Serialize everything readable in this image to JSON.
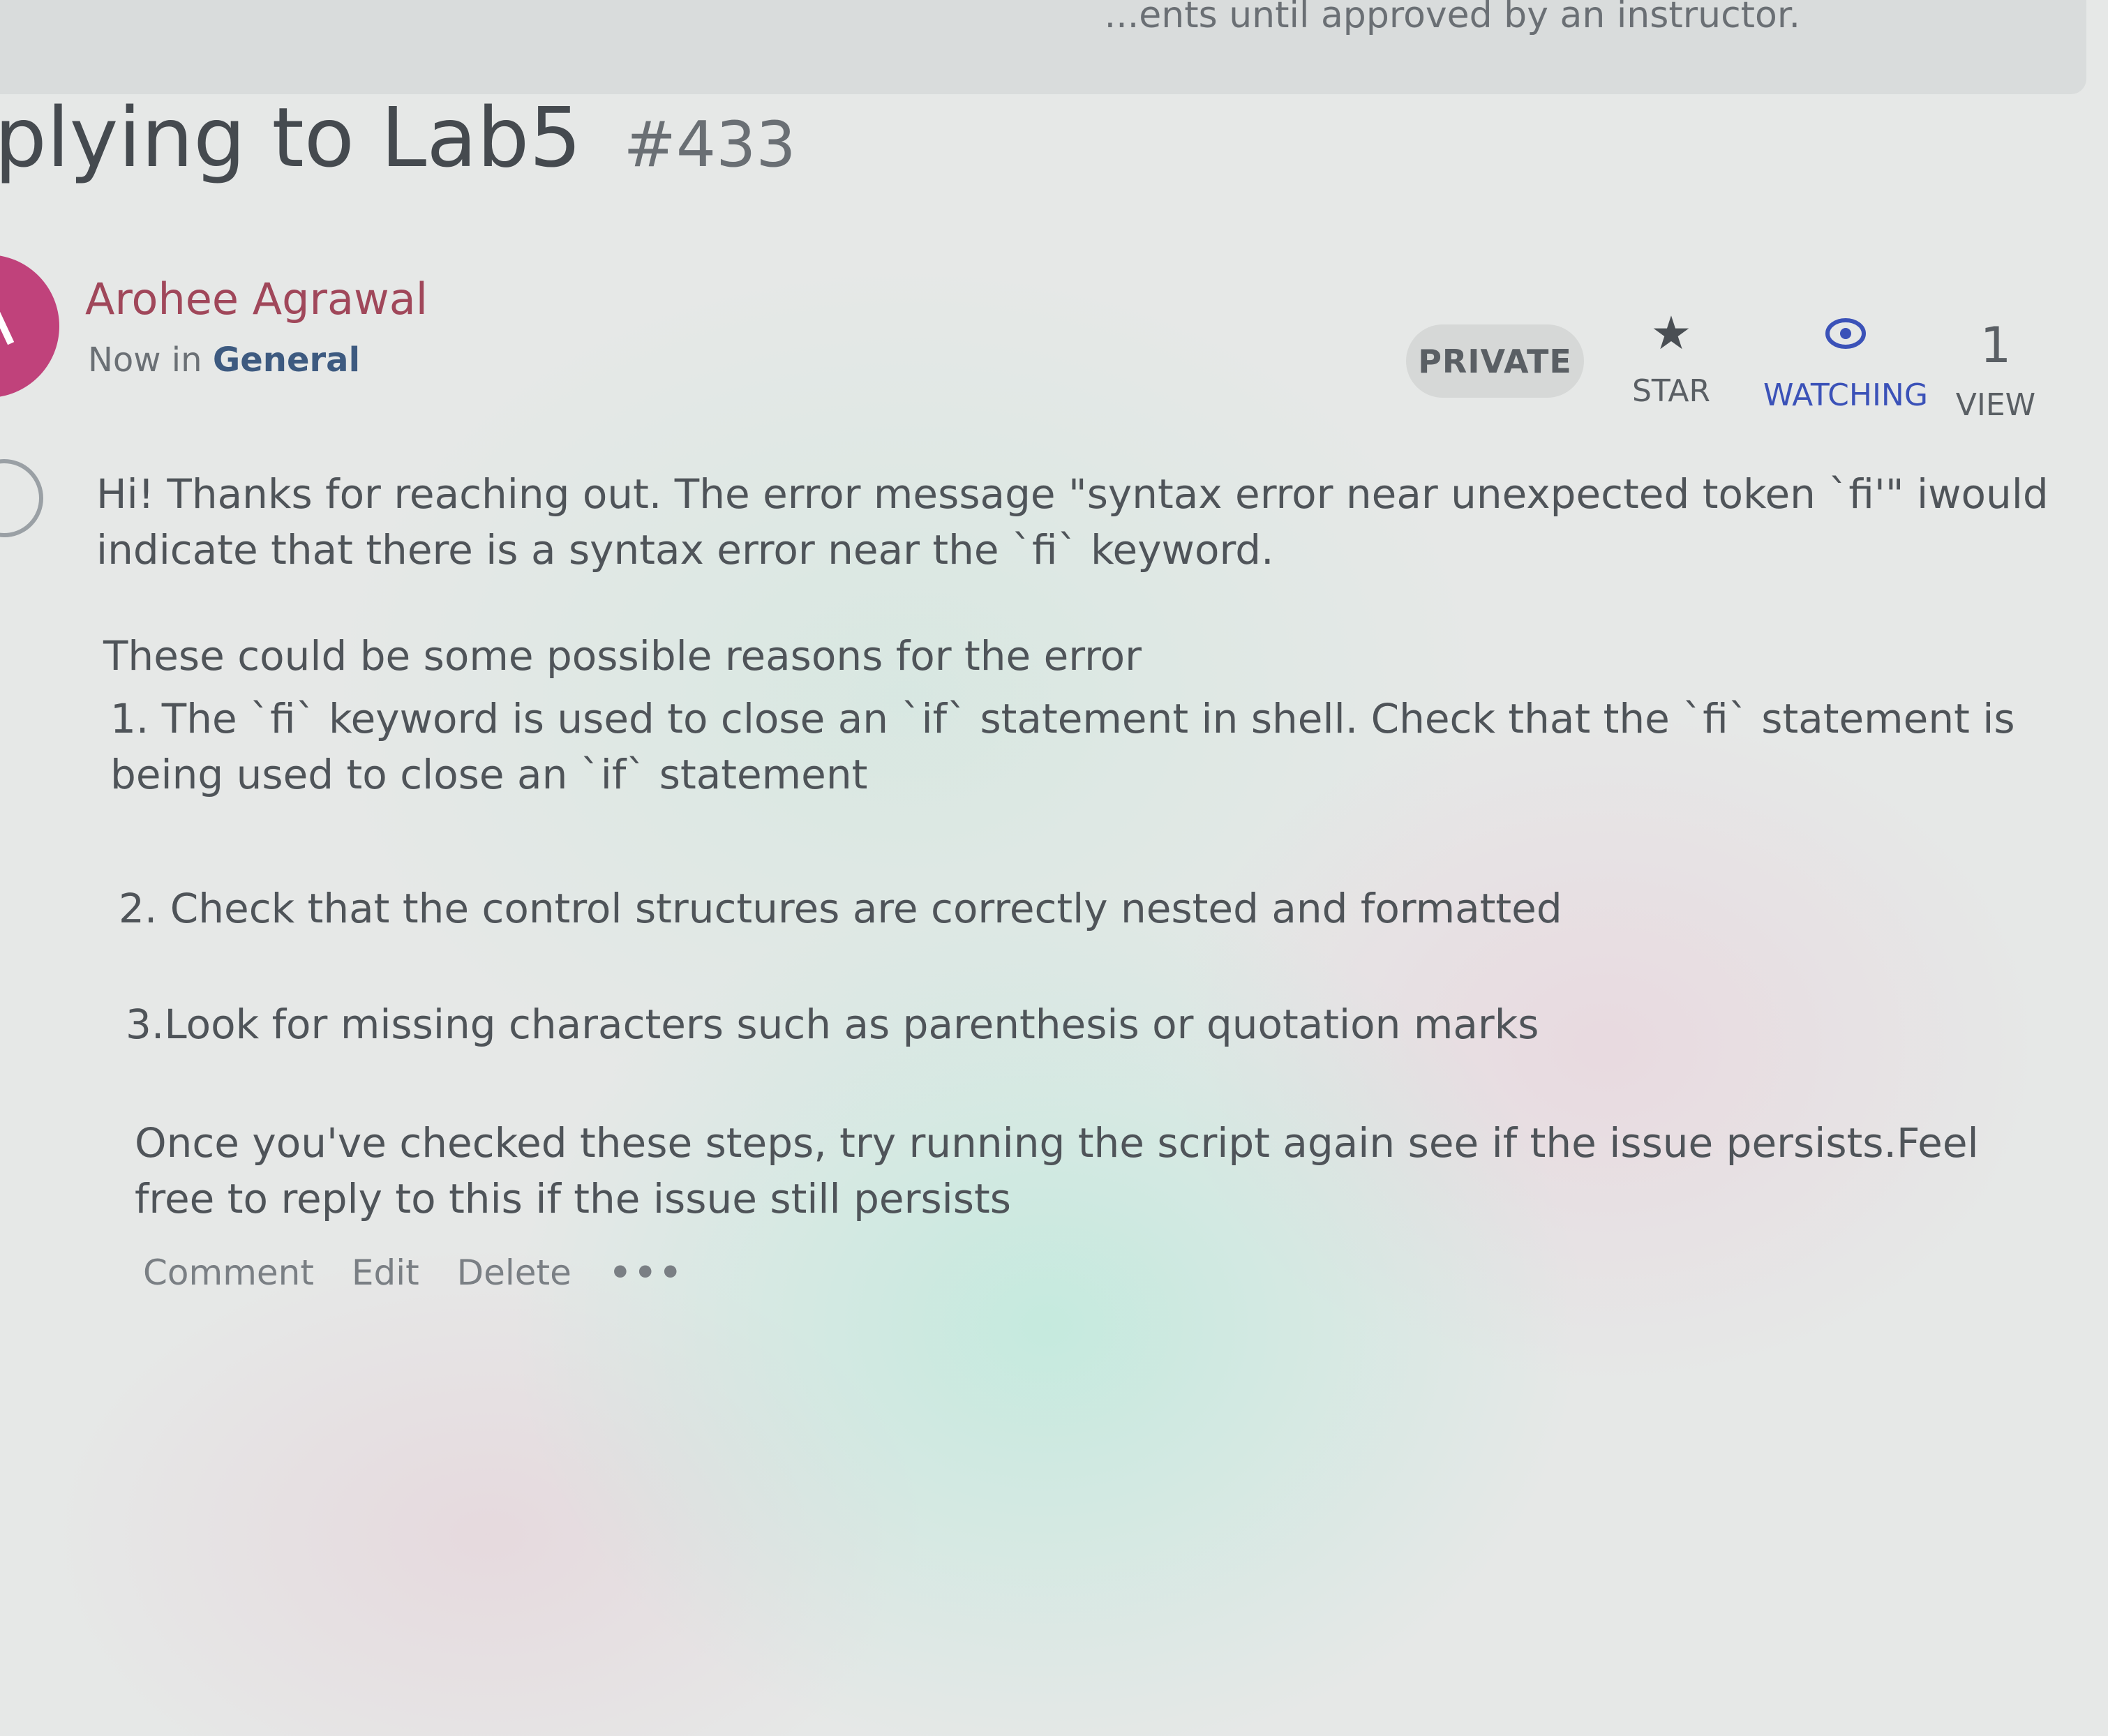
{
  "banner": {
    "text": "...ents until approved by an instructor."
  },
  "post": {
    "title": "plying to Lab5",
    "number": "#433"
  },
  "author": {
    "name": "Arohee Agrawal",
    "time": "Now",
    "in_word": "in",
    "category": "General"
  },
  "actions": {
    "private_label": "PRIVATE",
    "star_label": "STAR",
    "watching_label": "WATCHING",
    "view_count": "1",
    "view_label": "VIEW"
  },
  "body": {
    "p1": "Hi! Thanks for reaching out. The error message \"syntax error near unexpected token `fi'\" iwould indicate that there is a syntax error near the `fi` keyword.",
    "p2": "These could be some possible reasons for the error",
    "p3": "1. The `fi` keyword is used to close an `if` statement in shell. Check that the `fi` statement is being used to close an `if` statement",
    "p4": "2. Check that the control structures are correctly nested and formatted",
    "p5": "3.Look for missing characters such as parenthesis or quotation marks",
    "p6": "Once you've checked these steps, try running the script again see if the issue persists.Feel free to reply to this if the issue still persists"
  },
  "footer": {
    "comment": "Comment",
    "edit": "Edit",
    "delete": "Delete",
    "more": "•••"
  },
  "colors": {
    "avatar": "#c0427b",
    "author_name": "#a0475a",
    "category": "#3d5a80",
    "watching": "#3b52b8"
  },
  "icons": {
    "star": "star-icon",
    "watching": "eye-icon",
    "more": "more-icon"
  }
}
